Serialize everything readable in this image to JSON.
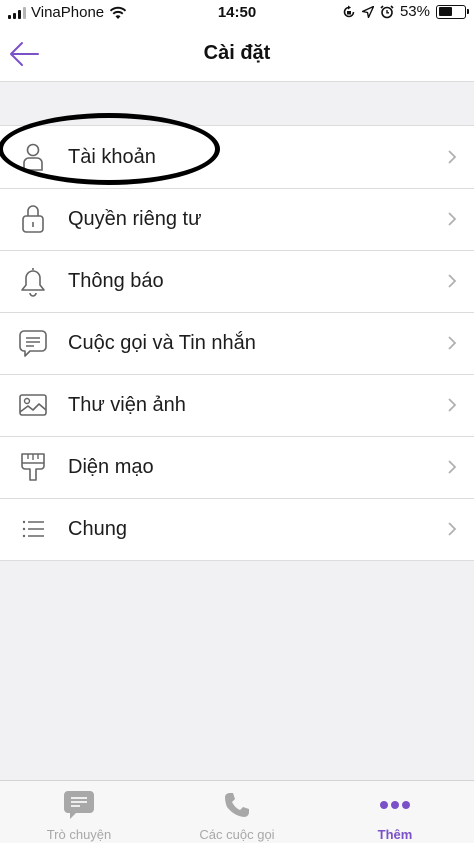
{
  "status_bar": {
    "carrier": "VinaPhone",
    "time": "14:50",
    "battery_percent": "53%",
    "battery_level": 0.53,
    "icons": [
      "signal-icon",
      "wifi-icon",
      "rotation-lock-icon",
      "location-arrow-icon",
      "alarm-icon",
      "battery-icon"
    ]
  },
  "header": {
    "title": "Cài đặt",
    "back_icon": "arrow-left-icon"
  },
  "settings": {
    "items": [
      {
        "label": "Tài khoản",
        "icon": "person-icon"
      },
      {
        "label": "Quyền riêng tư",
        "icon": "lock-icon"
      },
      {
        "label": "Thông báo",
        "icon": "bell-icon"
      },
      {
        "label": "Cuộc gọi và Tin nhắn",
        "icon": "chat-bubble-icon"
      },
      {
        "label": "Thư viện ảnh",
        "icon": "image-icon"
      },
      {
        "label": "Diện mạo",
        "icon": "paint-brush-icon"
      },
      {
        "label": "Chung",
        "icon": "list-icon"
      }
    ],
    "highlighted_item": "Tài khoản"
  },
  "tab_bar": {
    "tabs": [
      {
        "label": "Trò chuyện",
        "icon": "chat-icon",
        "active": false
      },
      {
        "label": "Các cuộc gọi",
        "icon": "phone-icon",
        "active": false
      },
      {
        "label": "Thêm",
        "icon": "more-dots-icon",
        "active": true
      }
    ]
  },
  "colors": {
    "accent": "#7b51c8",
    "background": "#f1f1f4",
    "inactive_tab": "#a8a8a8",
    "divider": "#dcdcdc"
  }
}
